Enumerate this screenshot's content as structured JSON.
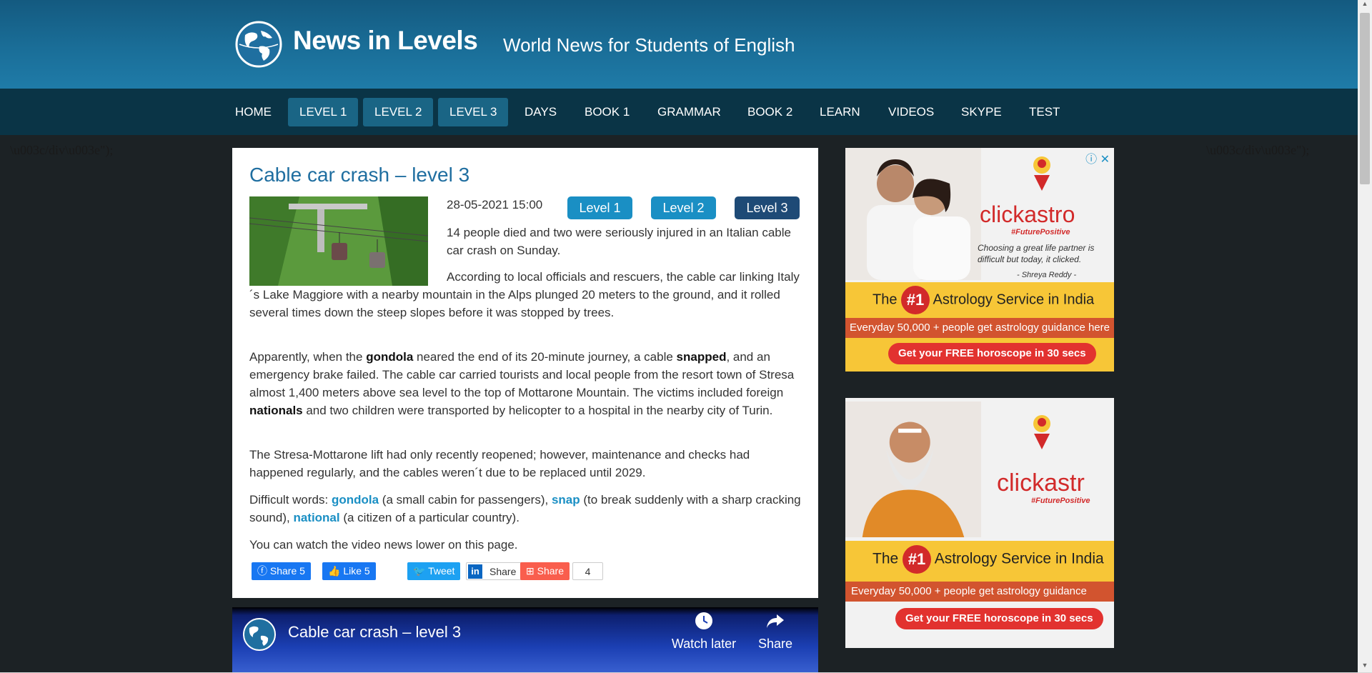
{
  "header": {
    "logo_text": "News in Levels",
    "tagline": "World News for Students of English"
  },
  "nav": {
    "items": [
      {
        "label": "HOME"
      },
      {
        "label": "LEVEL 1"
      },
      {
        "label": "LEVEL 2"
      },
      {
        "label": "LEVEL 3"
      },
      {
        "label": "DAYS"
      },
      {
        "label": "BOOK 1"
      },
      {
        "label": "GRAMMAR"
      },
      {
        "label": "BOOK 2"
      },
      {
        "label": "LEARN"
      },
      {
        "label": "VIDEOS"
      },
      {
        "label": "SKYPE"
      },
      {
        "label": "TEST"
      }
    ]
  },
  "artifacts": {
    "left": "\\u003c/div\\u003e\");",
    "right": "\\u003c/div\\u003e\");"
  },
  "article": {
    "title": "Cable car crash – level 3",
    "date": "28-05-2021 15:00",
    "level_buttons": [
      "Level 1",
      "Level 2",
      "Level 3"
    ],
    "p1": "14 people died and two were seriously injured in an Italian cable car crash on Sunday.",
    "p2": "According to local officials and rescuers, the cable car linking Italy´s Lake Maggiore with a nearby mountain in the Alps plunged 20 meters to the ground, and it rolled several times down the steep slopes before it was stopped by trees.",
    "p3_a": "Apparently, when the ",
    "p3_b1": "gondola",
    "p3_c": " neared the end of its 20-minute journey, a cable ",
    "p3_b2": "snapped",
    "p3_d": ", and an emergency brake failed. The cable car carried tourists and local people from the resort town of Stresa almost 1,400 meters above sea level to the top of Mottarone Mountain. The victims included foreign ",
    "p3_b3": "nationals",
    "p3_e": " and two children were transported by helicopter to a hospital in the nearby city of Turin.",
    "p4": "The Stresa-Mottarone lift had only recently reopened; however, maintenance and checks had happened regularly, and the cables weren´t due to be replaced until 2029.",
    "dw_label": "Difficult words: ",
    "dw1_word": "gondola",
    "dw1_def": " (a small cabin for passengers), ",
    "dw2_word": "snap",
    "dw2_def": " (to break suddenly with a sharp cracking sound), ",
    "dw3_word": "national",
    "dw3_def": " (a citizen of a particular country).",
    "p6": "You can watch the video news lower on this page."
  },
  "share": {
    "fb_share": "Share 5",
    "fb_like": "Like 5",
    "tweet": "Tweet",
    "linkedin": "Share",
    "share": "Share",
    "count": "4"
  },
  "video": {
    "title": "Cable car crash – level 3",
    "watch_later": "Watch later",
    "share": "Share"
  },
  "ads": {
    "brand": "clickastro",
    "brand_sub": "#FuturePositive",
    "quote": "Choosing a great life partner is difficult but today, it clicked.",
    "quote_author": "- Shreya Reddy -",
    "headline_pre": "The",
    "headline_num": "#1",
    "headline_post": "Astrology Service in India",
    "redbar": "Everyday 50,000 + people get astrology guidance here",
    "cta": "Get your FREE horoscope in 30 secs",
    "ad2_brand": "clickastr",
    "ad2_headline_post": "Astrology Service in India",
    "ad2_redbar": "Everyday 50,000 + people get astrology guidance",
    "accent": "#d22a2a"
  }
}
